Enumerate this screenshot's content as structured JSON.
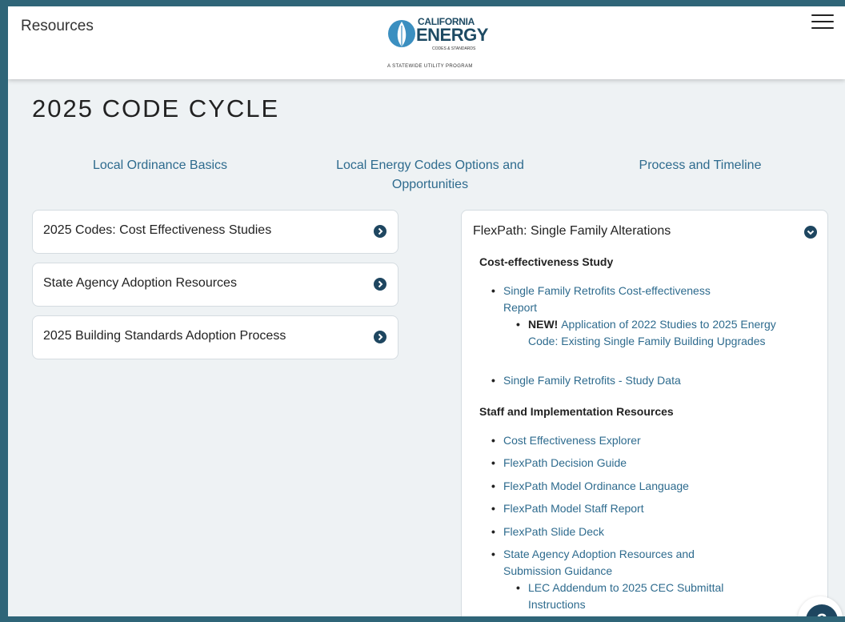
{
  "header": {
    "title": "Resources",
    "logo": {
      "line1": "CALIFORNIA",
      "line2": "ENERGY",
      "line3": "CODES & STANDARDS",
      "tagline": "A STATEWIDE UTILITY PROGRAM"
    },
    "menu_icon": "hamburger-icon"
  },
  "page_title": "2025 CODE CYCLE",
  "nav_links": [
    "Local Ordinance Basics",
    "Local Energy Codes Options and Opportunities",
    "Process and Timeline"
  ],
  "accordions": [
    "2025 Codes: Cost Effectiveness Studies",
    "State Agency Adoption Resources",
    "2025 Building Standards Adoption Process"
  ],
  "flexpath": {
    "title": "FlexPath: Single Family Alterations",
    "section1": {
      "heading": "Cost-effectiveness Study",
      "items": [
        "Single Family Retrofits Cost-effectiveness Report",
        "Application of 2022 Studies to 2025 Energy Code: Existing Single Family Building Upgrades",
        "Single Family Retrofits - Study Data"
      ],
      "new_tag": "NEW!"
    },
    "section2": {
      "heading": "Staff and Implementation Resources",
      "items": [
        "Cost Effectiveness Explorer",
        "FlexPath Decision Guide",
        "FlexPath Model Ordinance Language",
        "FlexPath Model Staff Report",
        "FlexPath Slide Deck",
        "State Agency Adoption Resources and Submission Guidance",
        "LEC Addendum to 2025 CEC Submittal Instructions"
      ]
    }
  },
  "help_button": "?",
  "colors": {
    "border": "#2f6578",
    "link": "#2e6b8e",
    "chevron": "#1e4660",
    "background": "#eef2f4"
  }
}
